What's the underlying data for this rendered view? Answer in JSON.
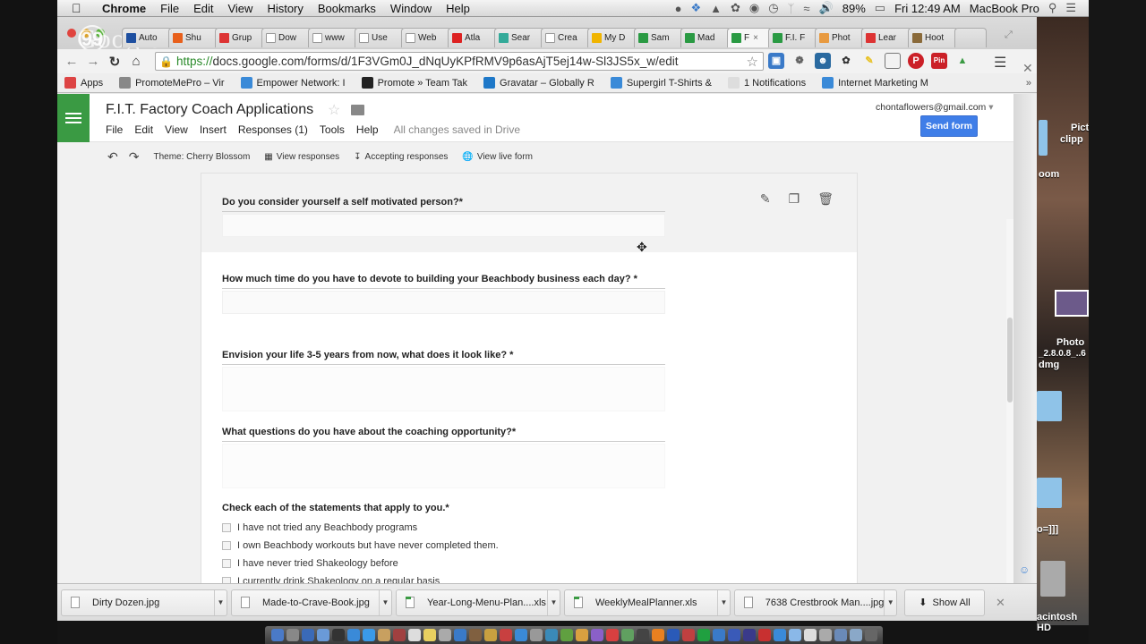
{
  "menubar": {
    "apple": "",
    "items": [
      "Chrome",
      "File",
      "Edit",
      "View",
      "History",
      "Bookmarks",
      "Window",
      "Help"
    ],
    "status_icons": [
      "notification-icon",
      "dropbox-icon",
      "google-drive-icon",
      "evernote-icon",
      "stack-icon",
      "time-machine-icon",
      "bluetooth-icon",
      "wifi-icon",
      "volume-icon"
    ],
    "battery": "89%",
    "clock": "Fri 12:49 AM",
    "user": "MacBook Pro"
  },
  "browser": {
    "overlay_logo": "Google+",
    "tabs": [
      {
        "label": "Auto",
        "color": "#1e4fa0"
      },
      {
        "label": "Shu",
        "color": "#e8601c"
      },
      {
        "label": "Grup",
        "color": "#d33"
      },
      {
        "label": "Dow",
        "color": "#fff"
      },
      {
        "label": "www",
        "color": "#fff"
      },
      {
        "label": "Use",
        "color": "#fff"
      },
      {
        "label": "Web",
        "color": "#fff"
      },
      {
        "label": "Atla",
        "color": "#d22"
      },
      {
        "label": "Sear",
        "color": "#3a9"
      },
      {
        "label": "Crea",
        "color": "#fff"
      },
      {
        "label": "My D",
        "color": "#f0b400"
      },
      {
        "label": "Sam",
        "color": "#2a9a43"
      },
      {
        "label": "Mad",
        "color": "#2a9a43"
      },
      {
        "label": "F",
        "color": "#2a9a43",
        "active": true
      },
      {
        "label": "F.I. F",
        "color": "#2a9a43"
      },
      {
        "label": "Phot",
        "color": "#e89a40"
      },
      {
        "label": "Lear",
        "color": "#d33"
      },
      {
        "label": "Hoot",
        "color": "#8a6a3a"
      }
    ],
    "url_scheme": "https://",
    "url_rest": "docs.google.com/forms/d/1F3VGm0J_dNqUyKPfRMV9p6asAjT5ej14w-Sl3JS5x_w/edit",
    "bookmarks": [
      {
        "label": "Apps",
        "color": "#d44"
      },
      {
        "label": "PromoteMePro – Vir",
        "color": "#888"
      },
      {
        "label": "Empower Network: I",
        "color": "#3a8ad8"
      },
      {
        "label": "Promote » Team Tak",
        "color": "#222"
      },
      {
        "label": "Gravatar – Globally R",
        "color": "#1e78c8"
      },
      {
        "label": "Supergirl T-Shirts &",
        "color": "#3a8ad8"
      },
      {
        "label": "1 Notifications",
        "color": "#ddd"
      },
      {
        "label": "Internet Marketing M",
        "color": "#3a8ad8"
      }
    ],
    "bookmarks_more": "»"
  },
  "forms": {
    "title": "F.I.T. Factory Coach Applications",
    "menu": [
      "File",
      "Edit",
      "View",
      "Insert",
      "Responses (1)",
      "Tools",
      "Help"
    ],
    "saved_status": "All changes saved in Drive",
    "account": "chontaflowers@gmail.com",
    "send_button": "Send form",
    "toolbar": {
      "theme": "Theme: Cherry Blossom",
      "view_responses": "View responses",
      "accepting": "Accepting responses",
      "view_live": "View live form"
    },
    "questions": [
      {
        "label": "Do you consider yourself a self motivated person?*"
      },
      {
        "label": "How much time do you have to devote to building your Beachbody business each day? *"
      },
      {
        "label": "Envision your life 3-5 years from now, what does it look like? *"
      },
      {
        "label": "What questions do you have about the coaching opportunity?*"
      }
    ],
    "checkbox_question": {
      "label": "Check each of the statements that apply to you.*",
      "options": [
        "I have not tried any Beachbody programs",
        "I own Beachbody workouts but have never completed them.",
        "I have never tried Shakeology before",
        "I currently drink Shakeology on a regular basis"
      ]
    }
  },
  "downloads": {
    "items": [
      {
        "name": "Dirty Dozen.jpg",
        "type": "jpg"
      },
      {
        "name": "Made-to-Crave-Book.jpg",
        "type": "jpg"
      },
      {
        "name": "Year-Long-Menu-Plan....xls",
        "type": "xls"
      },
      {
        "name": "WeeklyMealPlanner.xls",
        "type": "xls"
      },
      {
        "name": "7638 Crestbrook Man....jpg",
        "type": "jpg"
      }
    ],
    "show_all": "Show All"
  },
  "desktop": {
    "labels": [
      "Pict",
      "clipp",
      "oom",
      "Photo",
      "_2.8.0.8_..6",
      "dmg",
      "o=]]]",
      "acintosh HD"
    ]
  }
}
